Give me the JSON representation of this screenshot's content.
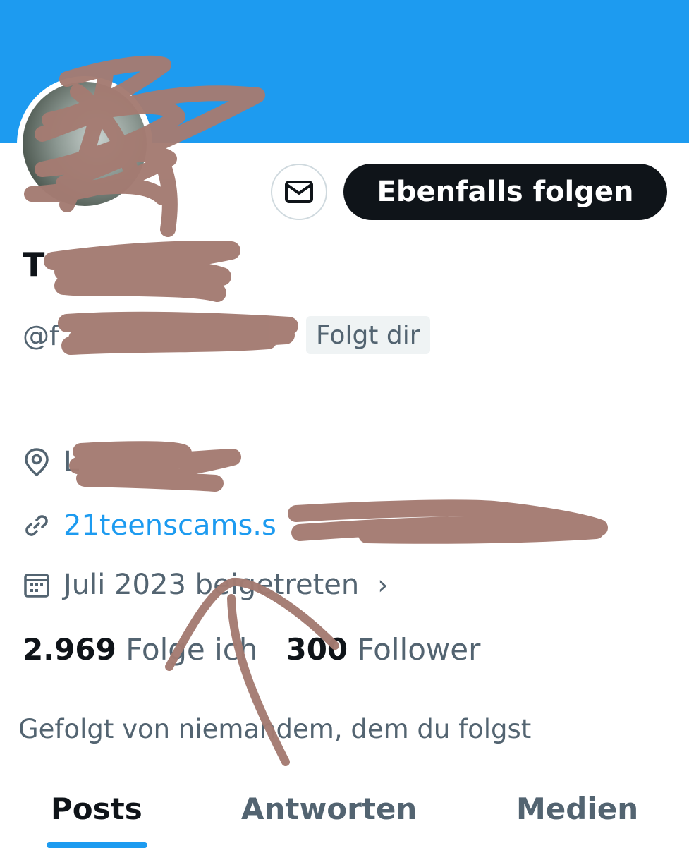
{
  "profile": {
    "display_name": "T",
    "handle": "@f",
    "follows_you_badge": "Folgt dir",
    "location": "L",
    "website": "21teenscams.s",
    "joined": "Juli 2023 beigetreten",
    "joined_chevron": "›"
  },
  "actions": {
    "message_icon": "envelope-icon",
    "follow_back_label": "Ebenfalls folgen"
  },
  "stats": {
    "following_count": "2.969",
    "following_label": "Folge ich",
    "followers_count": "300",
    "followers_label": "Follower"
  },
  "followed_by_text": "Gefolgt von niemandem, dem du folgst",
  "tabs": [
    {
      "label": "Posts",
      "active": true
    },
    {
      "label": "Antworten",
      "active": false
    },
    {
      "label": "Medien",
      "active": false
    }
  ],
  "colors": {
    "banner": "#1d9bf0",
    "link": "#1d9bf0",
    "primary_button": "#0f1419",
    "muted_text": "#536471",
    "redaction_marker": "#a47b72"
  }
}
